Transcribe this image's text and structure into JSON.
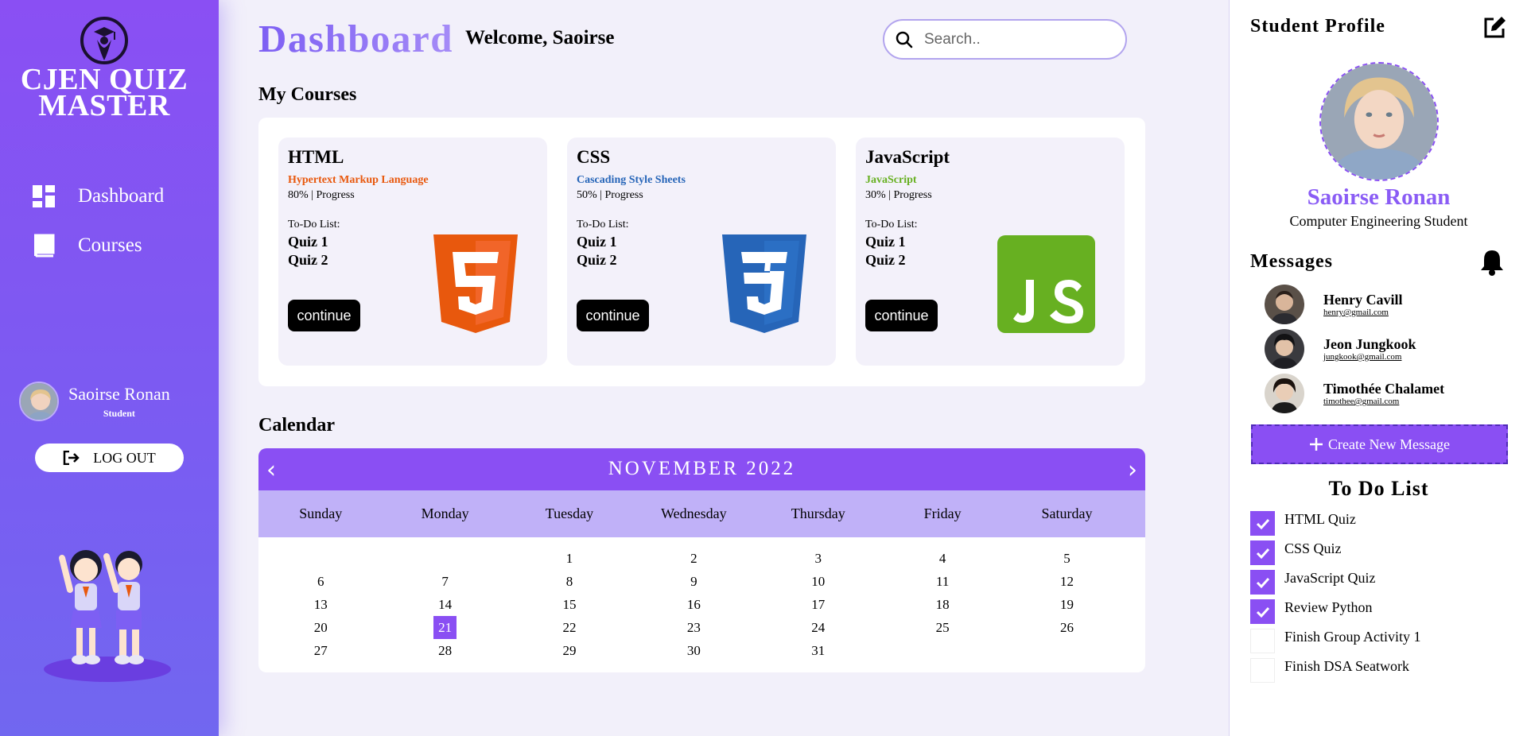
{
  "app": {
    "name": "CJEN QUIZ MASTER"
  },
  "colors": {
    "accent": "#8a4ff3",
    "html": "#e8580d",
    "css": "#2665b8",
    "js": "#67b021"
  },
  "sidebar": {
    "nav": [
      {
        "label": "Dashboard",
        "icon": "dashboard-icon"
      },
      {
        "label": "Courses",
        "icon": "book-icon"
      }
    ],
    "user": {
      "name": "Saoirse Ronan",
      "role": "Student"
    },
    "logout_label": "LOG OUT"
  },
  "header": {
    "title": "Dashboard",
    "welcome": "Welcome, Saoirse",
    "search_placeholder": "Search.."
  },
  "courses": {
    "title": "My Courses",
    "items": [
      {
        "name": "HTML",
        "subtitle": "Hypertext Markup Language",
        "progress": "80% | Progress",
        "todo_label": "To-Do List:",
        "quizzes": [
          "Quiz 1",
          "Quiz 2"
        ],
        "button": "continue"
      },
      {
        "name": "CSS",
        "subtitle": "Cascading Style Sheets",
        "progress": "50% | Progress",
        "todo_label": "To-Do List:",
        "quizzes": [
          "Quiz 1",
          "Quiz 2"
        ],
        "button": "continue"
      },
      {
        "name": "JavaScript",
        "subtitle": "JavaScript",
        "progress": "30% | Progress",
        "todo_label": "To-Do List:",
        "quizzes": [
          "Quiz 1",
          "Quiz 2"
        ],
        "button": "continue"
      }
    ]
  },
  "calendar": {
    "title": "Calendar",
    "month": "NOVEMBER 2022",
    "prev": "‹",
    "next": "›",
    "days": [
      "Sunday",
      "Monday",
      "Tuesday",
      "Wednesday",
      "Thursday",
      "Friday",
      "Saturday"
    ],
    "weeks": [
      [
        "",
        "",
        "1",
        "2",
        "3",
        "4",
        "5"
      ],
      [
        "6",
        "7",
        "8",
        "9",
        "10",
        "11",
        "12"
      ],
      [
        "13",
        "14",
        "15",
        "16",
        "17",
        "18",
        "19"
      ],
      [
        "20",
        "21",
        "22",
        "23",
        "24",
        "25",
        "26"
      ],
      [
        "27",
        "28",
        "29",
        "30",
        "31",
        "",
        ""
      ]
    ],
    "today": "21"
  },
  "profile": {
    "title": "Student Profile",
    "name": "Saoirse Ronan",
    "role": "Computer Engineering Student"
  },
  "messages": {
    "title": "Messages",
    "items": [
      {
        "name": "Henry Cavill",
        "email": "henry@gmail.com"
      },
      {
        "name": "Jeon Jungkook",
        "email": "jungkook@gmail.com"
      },
      {
        "name": "Timothée Chalamet",
        "email": "timothee@gmail.com"
      }
    ],
    "new_button": "Create New Message"
  },
  "todo": {
    "title": "To Do List",
    "items": [
      {
        "label": "HTML Quiz",
        "done": true
      },
      {
        "label": "CSS Quiz",
        "done": true
      },
      {
        "label": "JavaScript Quiz",
        "done": true
      },
      {
        "label": "Review Python",
        "done": true
      },
      {
        "label": "Finish Group Activity 1",
        "done": false
      },
      {
        "label": "Finish DSA Seatwork",
        "done": false
      }
    ]
  }
}
